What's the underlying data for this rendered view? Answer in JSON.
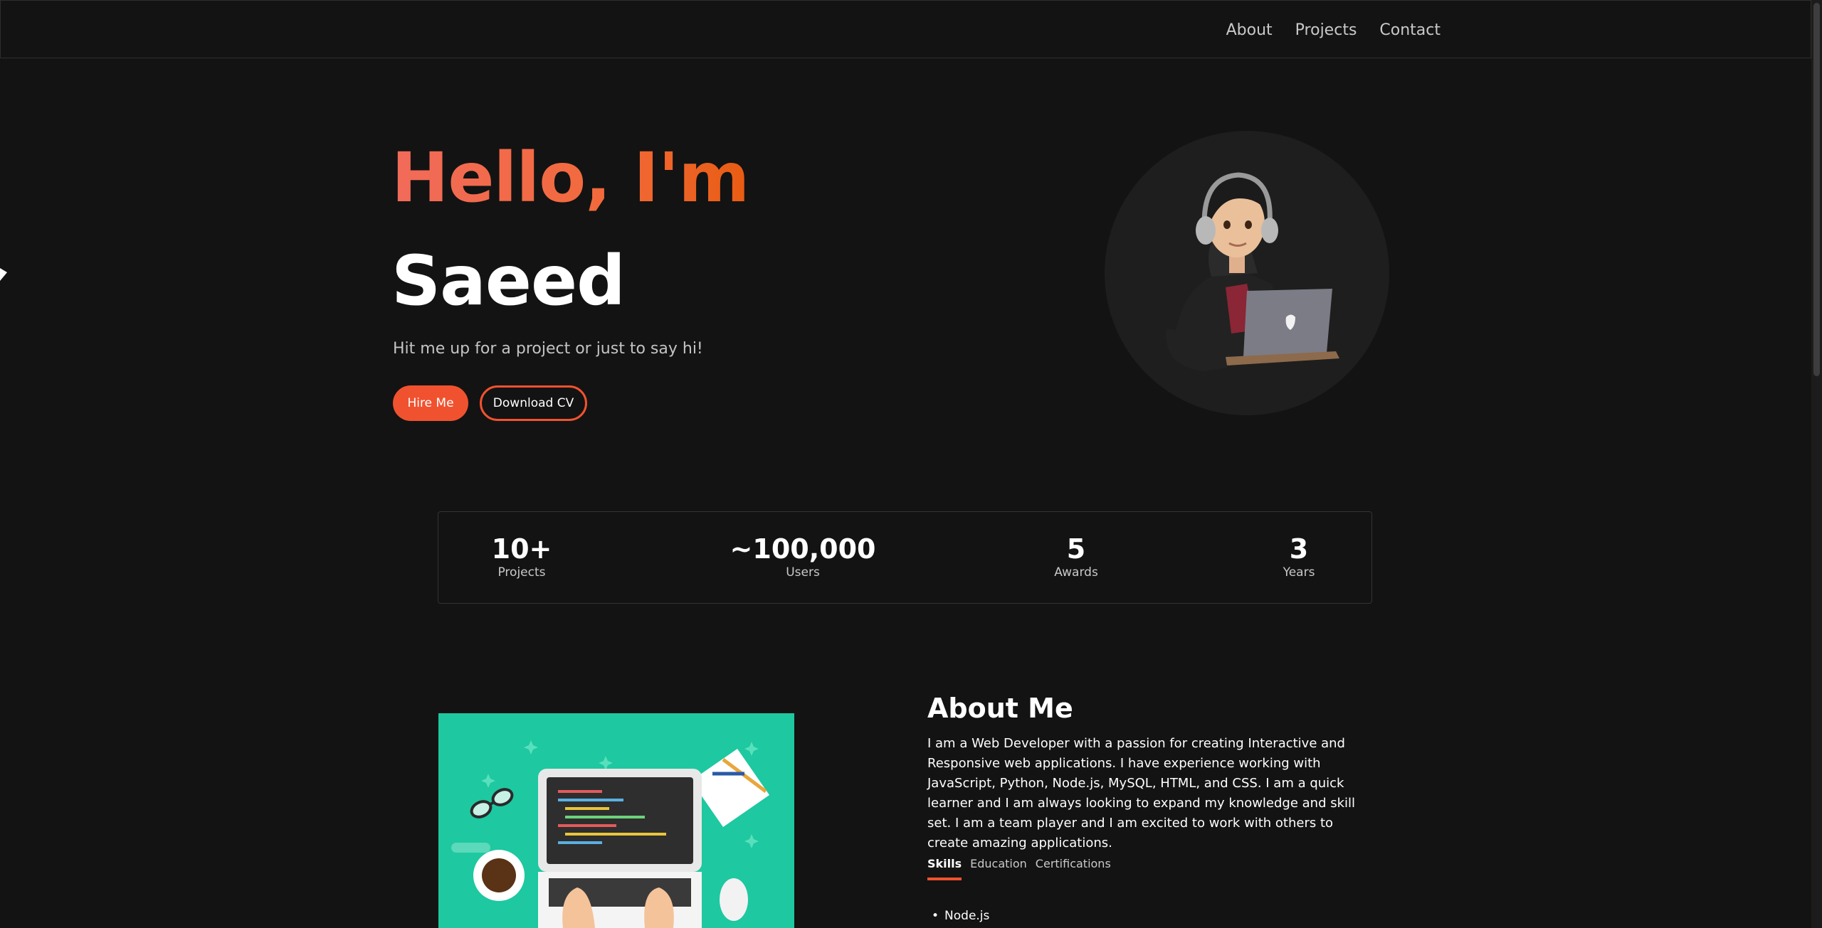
{
  "nav": {
    "links": [
      "About",
      "Projects",
      "Contact"
    ]
  },
  "hero": {
    "greeting": "Hello, I'm",
    "name": "Saeed",
    "tagline": "Hit me up for a project or just to say hi!",
    "hire_label": "Hire Me",
    "cv_label": "Download CV",
    "avatar_icon": "developer-avatar-illustration"
  },
  "stats": [
    {
      "value": "10+",
      "label": "Projects"
    },
    {
      "value": "~100,000",
      "label": "Users"
    },
    {
      "value": "5",
      "label": "Awards"
    },
    {
      "value": "3",
      "label": "Years"
    }
  ],
  "about": {
    "title": "About Me",
    "text": "I am a Web Developer with a passion for creating Interactive and Responsive web applications. I have experience working with JavaScript, Python, Node.js, MySQL, HTML, and CSS. I am a quick learner and I am always looking to expand my knowledge and skill set. I am a team player and I am excited to work with others to create amazing applications.",
    "tabs": [
      "Skills",
      "Education",
      "Certifications"
    ],
    "active_tab": "Skills",
    "skills": [
      "Node.js"
    ],
    "image_icon": "laptop-workspace-illustration"
  },
  "colors": {
    "background": "#131313",
    "accent": "#f0522f",
    "teal": "#1ec8a0"
  }
}
